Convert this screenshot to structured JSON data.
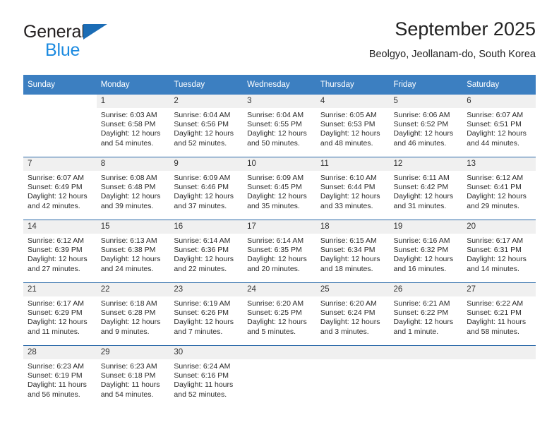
{
  "brand": {
    "name_part1": "General",
    "name_part2": "Blue",
    "triangle_color": "#1b6cb5",
    "blue_color": "#1b8ae0"
  },
  "header": {
    "title": "September 2025",
    "location": "Beolgyo, Jeollanam-do, South Korea"
  },
  "theme": {
    "header_bg": "#3c7fc1",
    "row_divider": "#2a69a8",
    "daynum_bg": "#f0f0f0",
    "text": "#2b2b2b"
  },
  "weekdays": [
    "Sunday",
    "Monday",
    "Tuesday",
    "Wednesday",
    "Thursday",
    "Friday",
    "Saturday"
  ],
  "weeks": [
    [
      {
        "day": "",
        "sunrise": "",
        "sunset": "",
        "daylight1": "",
        "daylight2": "",
        "state": "blank"
      },
      {
        "day": "1",
        "sunrise": "Sunrise: 6:03 AM",
        "sunset": "Sunset: 6:58 PM",
        "daylight1": "Daylight: 12 hours",
        "daylight2": "and 54 minutes.",
        "state": "filled"
      },
      {
        "day": "2",
        "sunrise": "Sunrise: 6:04 AM",
        "sunset": "Sunset: 6:56 PM",
        "daylight1": "Daylight: 12 hours",
        "daylight2": "and 52 minutes.",
        "state": "filled"
      },
      {
        "day": "3",
        "sunrise": "Sunrise: 6:04 AM",
        "sunset": "Sunset: 6:55 PM",
        "daylight1": "Daylight: 12 hours",
        "daylight2": "and 50 minutes.",
        "state": "filled"
      },
      {
        "day": "4",
        "sunrise": "Sunrise: 6:05 AM",
        "sunset": "Sunset: 6:53 PM",
        "daylight1": "Daylight: 12 hours",
        "daylight2": "and 48 minutes.",
        "state": "filled"
      },
      {
        "day": "5",
        "sunrise": "Sunrise: 6:06 AM",
        "sunset": "Sunset: 6:52 PM",
        "daylight1": "Daylight: 12 hours",
        "daylight2": "and 46 minutes.",
        "state": "filled"
      },
      {
        "day": "6",
        "sunrise": "Sunrise: 6:07 AM",
        "sunset": "Sunset: 6:51 PM",
        "daylight1": "Daylight: 12 hours",
        "daylight2": "and 44 minutes.",
        "state": "filled"
      }
    ],
    [
      {
        "day": "7",
        "sunrise": "Sunrise: 6:07 AM",
        "sunset": "Sunset: 6:49 PM",
        "daylight1": "Daylight: 12 hours",
        "daylight2": "and 42 minutes.",
        "state": "filled"
      },
      {
        "day": "8",
        "sunrise": "Sunrise: 6:08 AM",
        "sunset": "Sunset: 6:48 PM",
        "daylight1": "Daylight: 12 hours",
        "daylight2": "and 39 minutes.",
        "state": "filled"
      },
      {
        "day": "9",
        "sunrise": "Sunrise: 6:09 AM",
        "sunset": "Sunset: 6:46 PM",
        "daylight1": "Daylight: 12 hours",
        "daylight2": "and 37 minutes.",
        "state": "filled"
      },
      {
        "day": "10",
        "sunrise": "Sunrise: 6:09 AM",
        "sunset": "Sunset: 6:45 PM",
        "daylight1": "Daylight: 12 hours",
        "daylight2": "and 35 minutes.",
        "state": "filled"
      },
      {
        "day": "11",
        "sunrise": "Sunrise: 6:10 AM",
        "sunset": "Sunset: 6:44 PM",
        "daylight1": "Daylight: 12 hours",
        "daylight2": "and 33 minutes.",
        "state": "filled"
      },
      {
        "day": "12",
        "sunrise": "Sunrise: 6:11 AM",
        "sunset": "Sunset: 6:42 PM",
        "daylight1": "Daylight: 12 hours",
        "daylight2": "and 31 minutes.",
        "state": "filled"
      },
      {
        "day": "13",
        "sunrise": "Sunrise: 6:12 AM",
        "sunset": "Sunset: 6:41 PM",
        "daylight1": "Daylight: 12 hours",
        "daylight2": "and 29 minutes.",
        "state": "filled"
      }
    ],
    [
      {
        "day": "14",
        "sunrise": "Sunrise: 6:12 AM",
        "sunset": "Sunset: 6:39 PM",
        "daylight1": "Daylight: 12 hours",
        "daylight2": "and 27 minutes.",
        "state": "filled"
      },
      {
        "day": "15",
        "sunrise": "Sunrise: 6:13 AM",
        "sunset": "Sunset: 6:38 PM",
        "daylight1": "Daylight: 12 hours",
        "daylight2": "and 24 minutes.",
        "state": "filled"
      },
      {
        "day": "16",
        "sunrise": "Sunrise: 6:14 AM",
        "sunset": "Sunset: 6:36 PM",
        "daylight1": "Daylight: 12 hours",
        "daylight2": "and 22 minutes.",
        "state": "filled"
      },
      {
        "day": "17",
        "sunrise": "Sunrise: 6:14 AM",
        "sunset": "Sunset: 6:35 PM",
        "daylight1": "Daylight: 12 hours",
        "daylight2": "and 20 minutes.",
        "state": "filled"
      },
      {
        "day": "18",
        "sunrise": "Sunrise: 6:15 AM",
        "sunset": "Sunset: 6:34 PM",
        "daylight1": "Daylight: 12 hours",
        "daylight2": "and 18 minutes.",
        "state": "filled"
      },
      {
        "day": "19",
        "sunrise": "Sunrise: 6:16 AM",
        "sunset": "Sunset: 6:32 PM",
        "daylight1": "Daylight: 12 hours",
        "daylight2": "and 16 minutes.",
        "state": "filled"
      },
      {
        "day": "20",
        "sunrise": "Sunrise: 6:17 AM",
        "sunset": "Sunset: 6:31 PM",
        "daylight1": "Daylight: 12 hours",
        "daylight2": "and 14 minutes.",
        "state": "filled"
      }
    ],
    [
      {
        "day": "21",
        "sunrise": "Sunrise: 6:17 AM",
        "sunset": "Sunset: 6:29 PM",
        "daylight1": "Daylight: 12 hours",
        "daylight2": "and 11 minutes.",
        "state": "filled"
      },
      {
        "day": "22",
        "sunrise": "Sunrise: 6:18 AM",
        "sunset": "Sunset: 6:28 PM",
        "daylight1": "Daylight: 12 hours",
        "daylight2": "and 9 minutes.",
        "state": "filled"
      },
      {
        "day": "23",
        "sunrise": "Sunrise: 6:19 AM",
        "sunset": "Sunset: 6:26 PM",
        "daylight1": "Daylight: 12 hours",
        "daylight2": "and 7 minutes.",
        "state": "filled"
      },
      {
        "day": "24",
        "sunrise": "Sunrise: 6:20 AM",
        "sunset": "Sunset: 6:25 PM",
        "daylight1": "Daylight: 12 hours",
        "daylight2": "and 5 minutes.",
        "state": "filled"
      },
      {
        "day": "25",
        "sunrise": "Sunrise: 6:20 AM",
        "sunset": "Sunset: 6:24 PM",
        "daylight1": "Daylight: 12 hours",
        "daylight2": "and 3 minutes.",
        "state": "filled"
      },
      {
        "day": "26",
        "sunrise": "Sunrise: 6:21 AM",
        "sunset": "Sunset: 6:22 PM",
        "daylight1": "Daylight: 12 hours",
        "daylight2": "and 1 minute.",
        "state": "filled"
      },
      {
        "day": "27",
        "sunrise": "Sunrise: 6:22 AM",
        "sunset": "Sunset: 6:21 PM",
        "daylight1": "Daylight: 11 hours",
        "daylight2": "and 58 minutes.",
        "state": "filled"
      }
    ],
    [
      {
        "day": "28",
        "sunrise": "Sunrise: 6:23 AM",
        "sunset": "Sunset: 6:19 PM",
        "daylight1": "Daylight: 11 hours",
        "daylight2": "and 56 minutes.",
        "state": "filled"
      },
      {
        "day": "29",
        "sunrise": "Sunrise: 6:23 AM",
        "sunset": "Sunset: 6:18 PM",
        "daylight1": "Daylight: 11 hours",
        "daylight2": "and 54 minutes.",
        "state": "filled"
      },
      {
        "day": "30",
        "sunrise": "Sunrise: 6:24 AM",
        "sunset": "Sunset: 6:16 PM",
        "daylight1": "Daylight: 11 hours",
        "daylight2": "and 52 minutes.",
        "state": "filled"
      },
      {
        "day": "",
        "sunrise": "",
        "sunset": "",
        "daylight1": "",
        "daylight2": "",
        "state": "empty"
      },
      {
        "day": "",
        "sunrise": "",
        "sunset": "",
        "daylight1": "",
        "daylight2": "",
        "state": "empty"
      },
      {
        "day": "",
        "sunrise": "",
        "sunset": "",
        "daylight1": "",
        "daylight2": "",
        "state": "empty"
      },
      {
        "day": "",
        "sunrise": "",
        "sunset": "",
        "daylight1": "",
        "daylight2": "",
        "state": "empty"
      }
    ]
  ]
}
